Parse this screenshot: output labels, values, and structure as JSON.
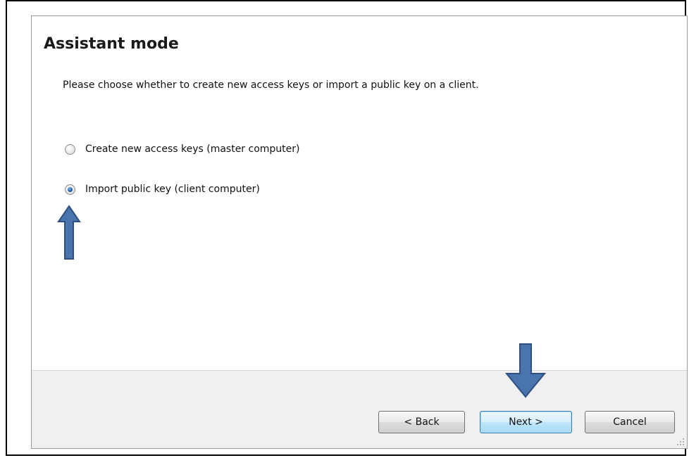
{
  "dialog": {
    "title": "Assistant mode",
    "description": "Please choose whether to create new access keys or import a public key on a client.",
    "options": [
      {
        "label": "Create new access keys (master computer)",
        "selected": false
      },
      {
        "label": "Import public key (client computer)",
        "selected": true
      }
    ]
  },
  "buttons": {
    "back_label": "< Back",
    "next_label": "Next >",
    "cancel_label": "Cancel"
  },
  "colors": {
    "arrow_fill": "#4a74ad",
    "arrow_stroke": "#2e4f80",
    "footer_bg": "#f0f0f0",
    "next_button_border": "#3c7fb1"
  },
  "icons": {
    "up_annotation": "arrow-up-icon",
    "down_annotation": "arrow-down-icon",
    "resize_grip": "resize-grip-icon"
  }
}
